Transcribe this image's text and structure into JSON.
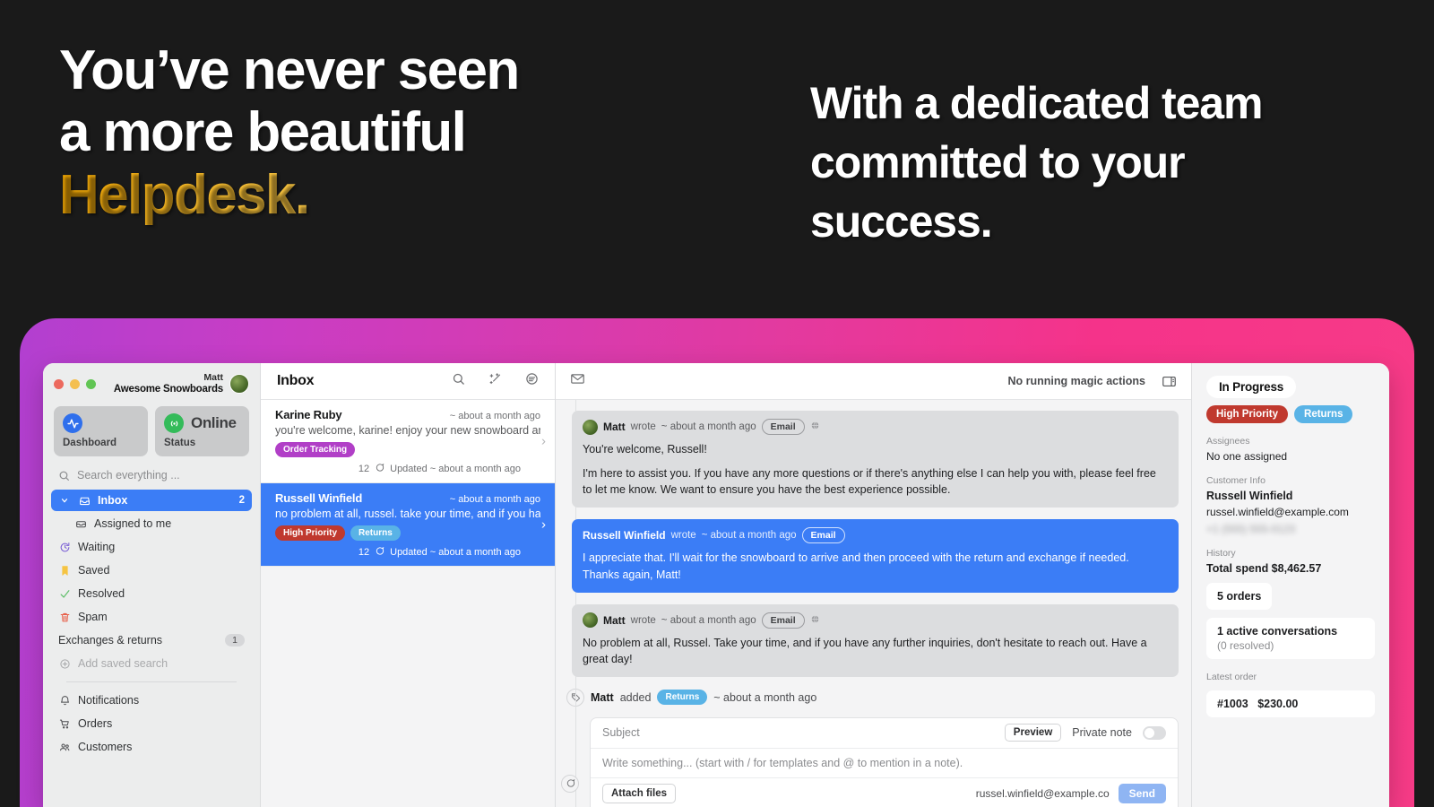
{
  "marketing": {
    "headline_left_line1": "You’ve never seen",
    "headline_left_line2": "a more beautiful",
    "headline_left_accent": "Helpdesk.",
    "headline_right": "With a dedicated team committed to your success.",
    "accent_color": "#ffc83d",
    "gradient_start": "#b23fd0",
    "gradient_end": "#f73b87"
  },
  "sidebar": {
    "user_name": "Matt",
    "org_name": "Awesome Snowboards",
    "cards": [
      {
        "label": "Dashboard",
        "icon": "activity-icon",
        "value": ""
      },
      {
        "label": "Status",
        "icon": "broadcast-icon",
        "value": "Online"
      }
    ],
    "search_placeholder": "Search everything ...",
    "items": [
      {
        "label": "Inbox",
        "icon": "inbox-icon",
        "count": "2",
        "active": true
      },
      {
        "label": "Assigned to me",
        "icon": "tray-icon",
        "count": ""
      },
      {
        "label": "Waiting",
        "icon": "clock-icon",
        "count": ""
      },
      {
        "label": "Saved",
        "icon": "bookmark-icon",
        "count": ""
      },
      {
        "label": "Resolved",
        "icon": "check-icon",
        "count": ""
      },
      {
        "label": "Spam",
        "icon": "trash-icon",
        "count": ""
      },
      {
        "label": "Exchanges & returns",
        "icon": "none",
        "badge": "1"
      },
      {
        "label": "Add saved search",
        "icon": "plus-circle-icon",
        "count": ""
      }
    ],
    "footer_items": [
      {
        "label": "Notifications",
        "icon": "bell-icon"
      },
      {
        "label": "Orders",
        "icon": "cart-icon"
      },
      {
        "label": "Customers",
        "icon": "people-icon"
      }
    ]
  },
  "conversations": {
    "title": "Inbox",
    "header_icons": [
      "search-icon",
      "magic-wand-icon",
      "filter-icon"
    ],
    "items": [
      {
        "name": "Karine Ruby",
        "time": "~ about a month ago",
        "snippet": "you're welcome, karine! enjoy your new snowboard and",
        "tags": [
          {
            "label": "Order Tracking",
            "cls": "order-tracking"
          }
        ],
        "message_count": "12",
        "updated": "Updated ~ about a month ago",
        "selected": false
      },
      {
        "name": "Russell Winfield",
        "time": "~ about a month ago",
        "snippet": "no problem at all, russel. take your time, and if you hav",
        "tags": [
          {
            "label": "High Priority",
            "cls": "high-priority"
          },
          {
            "label": "Returns",
            "cls": "returns"
          }
        ],
        "message_count": "12",
        "updated": "Updated ~ about a month ago",
        "selected": true
      }
    ]
  },
  "thread": {
    "channel_icon": "envelope-icon",
    "magic_status": "No running magic actions",
    "panel_toggle_icon": "panel-right-icon",
    "messages": [
      {
        "author": "Matt",
        "verb": "wrote",
        "time": "~ about a month ago",
        "channel": "Email",
        "kind": "agent",
        "has_avatar": true,
        "has_globe": true,
        "paragraphs": [
          "You're welcome, Russell!",
          "I'm here to assist you. If you have any more questions or if there's anything else I can help you with, please feel free to let me know. We want to ensure you have the best experience possible."
        ]
      },
      {
        "author": "Russell Winfield",
        "verb": "wrote",
        "time": "~ about a month ago",
        "channel": "Email",
        "kind": "customer",
        "has_avatar": false,
        "has_globe": false,
        "paragraphs": [
          "I appreciate that. I'll wait for the snowboard to arrive and then proceed with the return and exchange if needed. Thanks again, Matt!"
        ]
      },
      {
        "author": "Matt",
        "verb": "wrote",
        "time": "~ about a month ago",
        "channel": "Email",
        "kind": "agent",
        "has_avatar": true,
        "has_globe": true,
        "paragraphs": [
          "No problem at all, Russel. Take your time, and if you have any further inquiries, don't hesitate to reach out. Have a great day!"
        ]
      }
    ],
    "event": {
      "icon": "tag-icon",
      "actor": "Matt",
      "verb": "added",
      "tag": "Returns",
      "time": "~ about a month ago"
    }
  },
  "composer": {
    "subject_placeholder": "Subject",
    "preview_label": "Preview",
    "private_note_label": "Private note",
    "private_note_on": false,
    "body_placeholder": "Write something... (start with / for templates and @ to mention in a note).",
    "attach_label": "Attach files",
    "to_address": "russel.winfield@example.co",
    "send_label": "Send",
    "bubble_icon": "comment-icon"
  },
  "right_panel": {
    "status": "In Progress",
    "tags": [
      {
        "label": "High Priority",
        "cls": "high-priority"
      },
      {
        "label": "Returns",
        "cls": "returns"
      }
    ],
    "assignees_label": "Assignees",
    "assignees_value": "No one assigned",
    "customer_info_label": "Customer Info",
    "customer_name": "Russell Winfield",
    "customer_email": "russel.winfield@example.com",
    "customer_phone_redacted": "+1 (555) 555-0123",
    "history_label": "History",
    "total_spend": "Total spend $8,462.57",
    "orders_card": "5 orders",
    "conversations_card": "1 active conversations",
    "conversations_sub": "(0 resolved)",
    "latest_order_label": "Latest order",
    "latest_order_number": "#1003",
    "latest_order_amount": "$230.00"
  }
}
